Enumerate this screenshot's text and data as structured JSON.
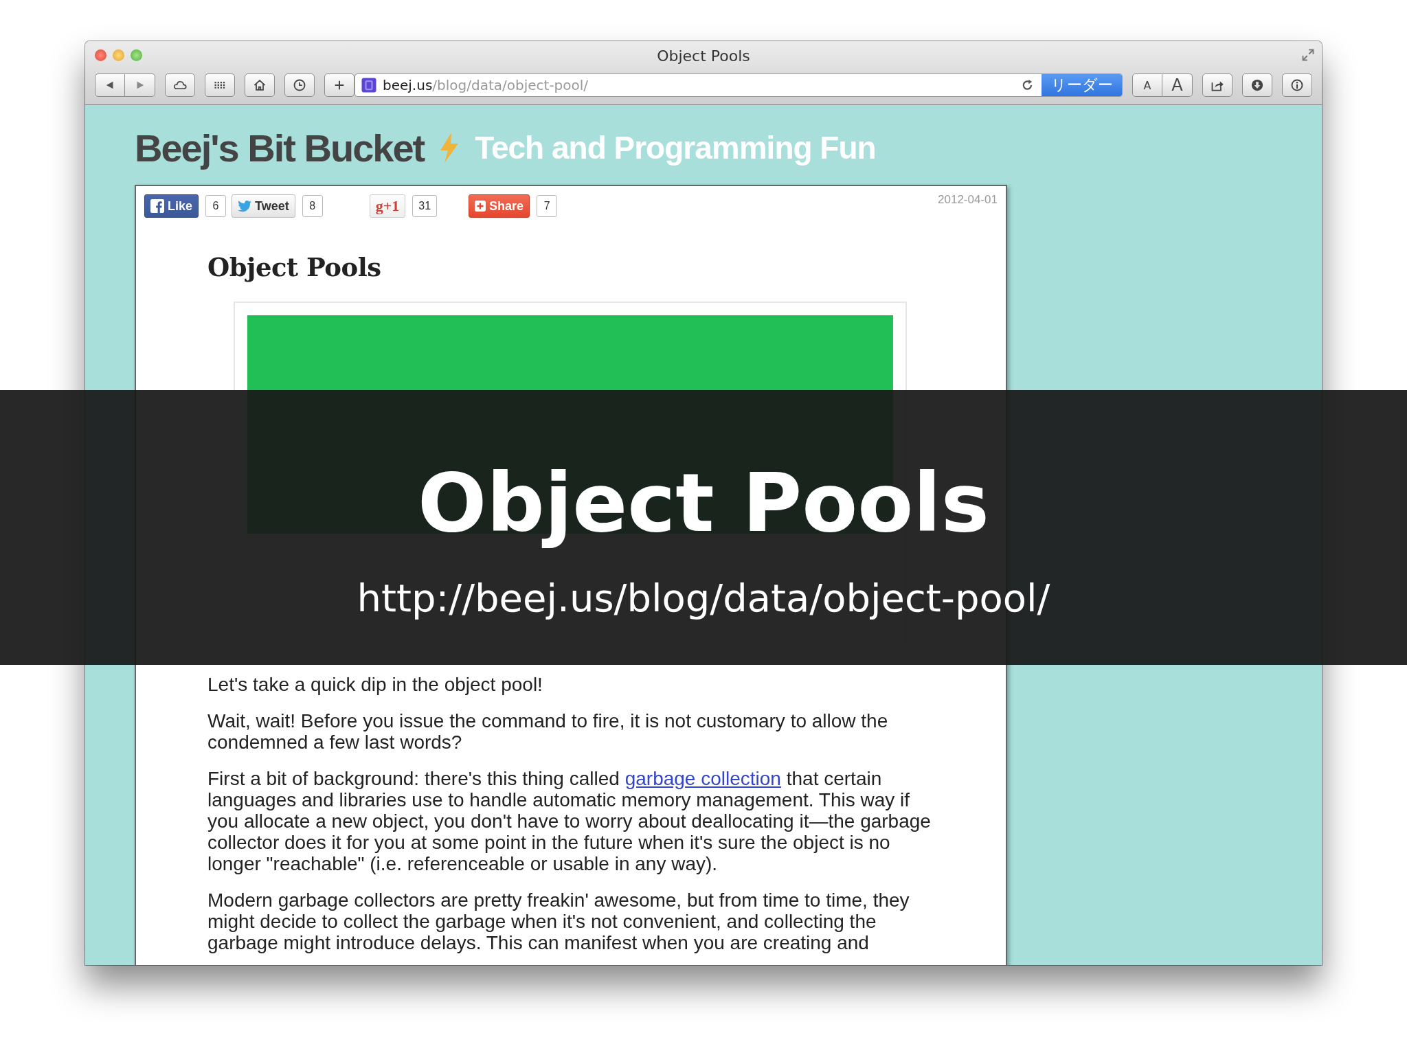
{
  "window": {
    "title": "Object Pools"
  },
  "toolbar": {
    "address": {
      "domain": "beej.us",
      "path": "/blog/data/object-pool/"
    },
    "reader_button": "リーダー",
    "font_buttons": [
      "A",
      "A"
    ]
  },
  "site": {
    "title": "Beej's Bit Bucket",
    "tagline": "Tech and Programming Fun"
  },
  "post": {
    "social": [
      {
        "kind": "facebook",
        "label": "Like",
        "count": "6"
      },
      {
        "kind": "twitter",
        "label": "Tweet",
        "count": "8"
      },
      {
        "kind": "google",
        "label": "g+1",
        "count": "31"
      },
      {
        "kind": "share",
        "label": "Share",
        "count": "7"
      }
    ],
    "date": "2012-04-01",
    "title": "Object Pools",
    "paragraphs": [
      {
        "parts": [
          {
            "kind": "text",
            "text": "Let's take a quick dip in the object pool!"
          }
        ]
      },
      {
        "parts": [
          {
            "kind": "text",
            "text": "Wait, wait! Before you issue the command to fire, it is not customary to allow the condemned a few last words?"
          }
        ]
      },
      {
        "parts": [
          {
            "kind": "text",
            "text": "First a bit of background: there's this thing called "
          },
          {
            "kind": "link",
            "text": "garbage collection"
          },
          {
            "kind": "text",
            "text": " that certain languages and libraries use to handle automatic memory management. This way if you allocate a new object, you don't have to worry about deallocating it—the garbage collector does it for you at some point in the future when it's sure the object is no longer \"reachable\" (i.e. referenceable or usable in any way)."
          }
        ]
      },
      {
        "parts": [
          {
            "kind": "text",
            "text": "Modern garbage collectors are pretty freakin' awesome, but from time to time, they might decide to collect the garbage when it's not convenient, and collecting the garbage might introduce delays. This can manifest when you are creating and"
          }
        ]
      }
    ]
  },
  "banner": {
    "title": "Object Pools",
    "url": "http://beej.us/blog/data/object-pool/"
  }
}
